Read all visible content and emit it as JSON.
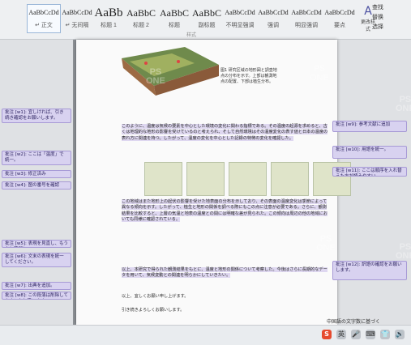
{
  "ribbon": {
    "styles": [
      {
        "sample": "AaBbCcDd",
        "label": "↵ 正文",
        "size": 8
      },
      {
        "sample": "AaBbCcDd",
        "label": "↵ 无间隔",
        "size": 8
      },
      {
        "sample": "AaBb",
        "label": "标题 1",
        "size": 15
      },
      {
        "sample": "AaBbC",
        "label": "标题 2",
        "size": 12
      },
      {
        "sample": "AaBbC",
        "label": "标题",
        "size": 12
      },
      {
        "sample": "AaBbC",
        "label": "副标题",
        "size": 12
      },
      {
        "sample": "AaBbCcDd",
        "label": "不明显强调",
        "size": 8
      },
      {
        "sample": "AaBbCcDd",
        "label": "强调",
        "size": 8
      },
      {
        "sample": "AaBbCcDd",
        "label": "明显强调",
        "size": 8
      },
      {
        "sample": "AaBbCcDd",
        "label": "要点",
        "size": 8
      }
    ],
    "styles_caption": "样式",
    "styles_pane_label": "更改样式",
    "right_commands": [
      "查找",
      "替换",
      "选择"
    ]
  },
  "document": {
    "map_caption": "图1 研究区域の地形図と調査地点の分布を示す。上部は観測地点の配置、下部は植生分布。",
    "paragraph1": "このように、温度は気候の要素を中心とした環境の変化に関わる指標である。その温度の起源を求めると、古くは地理的な地形の影響を受けているのと考えられ、そして自然環境はその温度変化の表す値と日本の温度の表れ方に関連を持つ。したがって、温度の変化を中心とした記録の特徴の変化を確認した。",
    "paragraph2": "この地域はまた地形上の起伏の影響を受けた地表面の分布を示しており、その表面の温度変化は季節によって異なる傾向を示す。したがって、植生と地形の関係を調べる際にもこの点に注意が必要である。さらに、観測結果を比較すると、上層の気温と地表の温度との間には明確な差が見られた。この傾向は周辺の他の地域においても同様に確認されている。",
    "paragraph3": "以上、本研究で得られた観測結果をもとに、温度と地形の関係について考察した。今後はさらに長期的なデータを用いて、気候変動との関連を明らかにしていきたい。",
    "closing1": "以上、宜しくお願い申し上げます。",
    "closing2": "引き続きよろしくお願いします。",
    "side_note": "中国語の文字数に基づく"
  },
  "comments": [
    {
      "text": "批注 [w1]: 宜しければ、引き続き確認をお願いします。"
    },
    {
      "text": "批注 [w2]: ここは「温度」で統一。"
    },
    {
      "text": "批注 [w3]: 修正済み"
    },
    {
      "text": "批注 [w4]: 图の番号を確認"
    },
    {
      "text": "批注 [w5]: 表現を見直し、もう少し簡潔に。"
    },
    {
      "text": "批注 [w6]: 文末の表現を統一してください。"
    },
    {
      "text": "批注 [w7]: 出典を追加。"
    },
    {
      "text": "批注 [w8]: この段落は削除してもよいかと思います。"
    },
    {
      "text": "批注 [w9]: 参考文献に追加"
    },
    {
      "text": "批注 [w10]: 用語を統一。"
    },
    {
      "text": "批注 [w11]: ここは順序を入れ替えた方が読みやすい。"
    },
    {
      "text": "批注 [w12]: 訳語の確認をお願いします。"
    }
  ],
  "watermark": {
    "line1": "PS",
    "line2": "ONE"
  },
  "taskbar": {
    "icons": [
      "S",
      "英",
      "🎤",
      "⌨",
      "👕",
      "🔊"
    ]
  }
}
